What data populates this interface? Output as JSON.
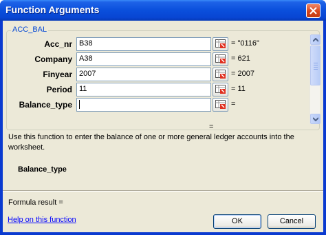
{
  "window": {
    "title": "Function Arguments"
  },
  "function_group": {
    "name": "ACC_BAL",
    "arguments": [
      {
        "label": "Acc_nr",
        "value": "B38",
        "result": "= \"0116\""
      },
      {
        "label": "Company",
        "value": "A38",
        "result": "= 621"
      },
      {
        "label": "Finyear",
        "value": "2007",
        "result": "= 2007"
      },
      {
        "label": "Period",
        "value": "11",
        "result": "= 11"
      },
      {
        "label": "Balance_type",
        "value": "",
        "result": "="
      }
    ]
  },
  "formula_equals": "=",
  "description": "Use this function to enter the balance of one or more general ledger accounts into the worksheet.",
  "selected_argument": "Balance_type",
  "formula_result": "Formula result =",
  "help_link": "Help on this function",
  "buttons": {
    "ok": "OK",
    "cancel": "Cancel"
  },
  "colors": {
    "titlebar": "#0a4fdc",
    "client": "#ece9d8",
    "group_label": "#0046d5",
    "link": "#0000ff"
  }
}
